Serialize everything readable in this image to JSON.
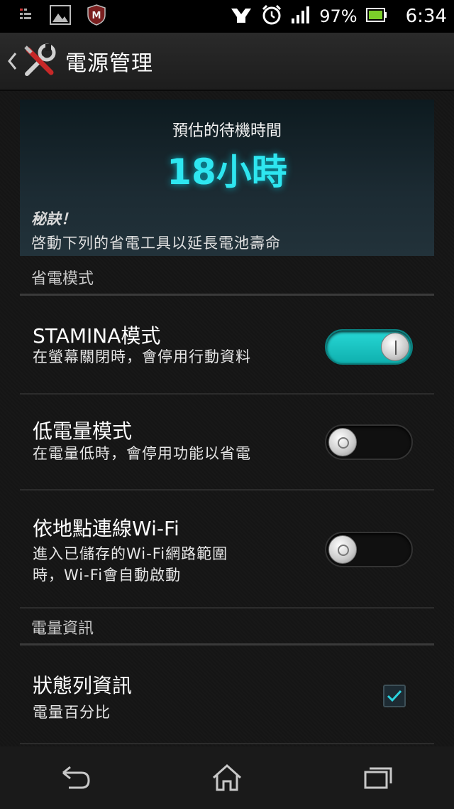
{
  "status_bar": {
    "battery_percent": "97%",
    "time": "6:34",
    "icons": [
      "notification-icon",
      "picture-icon",
      "mcafee-icon",
      "sony-icon",
      "alarm-icon",
      "signal-icon",
      "battery-icon"
    ]
  },
  "action_bar": {
    "title": "電源管理",
    "icons": [
      "back-chevron-icon",
      "tools-icon"
    ]
  },
  "estimate": {
    "label": "預估的待機時間",
    "value": "18小時",
    "tip_title": "秘訣！",
    "tip_text": "啓動下列的省電工具以延長電池壽命",
    "value_color": "#2ee6f0"
  },
  "sections": {
    "power_saving": "省電模式",
    "battery_info": "電量資訊"
  },
  "settings": {
    "stamina": {
      "title": "STAMINA模式",
      "subtitle": "在螢幕關閉時，會停用行動資料",
      "enabled": true
    },
    "low_battery": {
      "title": "低電量模式",
      "subtitle": "在電量低時，會停用功能以省電",
      "enabled": false
    },
    "location_wifi": {
      "title": "依地點連線Wi-Fi",
      "subtitle_line1": "進入已儲存的Wi-Fi網路範圍",
      "subtitle_line2": "時，Wi-Fi會自動啟動",
      "enabled": false
    },
    "status_bar_info": {
      "title": "狀態列資訊",
      "subtitle": "電量百分比",
      "checked": true
    }
  },
  "colors": {
    "accent": "#1fc8c6",
    "background": "#151515"
  },
  "nav_bar": {
    "icons": [
      "back-icon",
      "home-icon",
      "recent-apps-icon"
    ]
  }
}
